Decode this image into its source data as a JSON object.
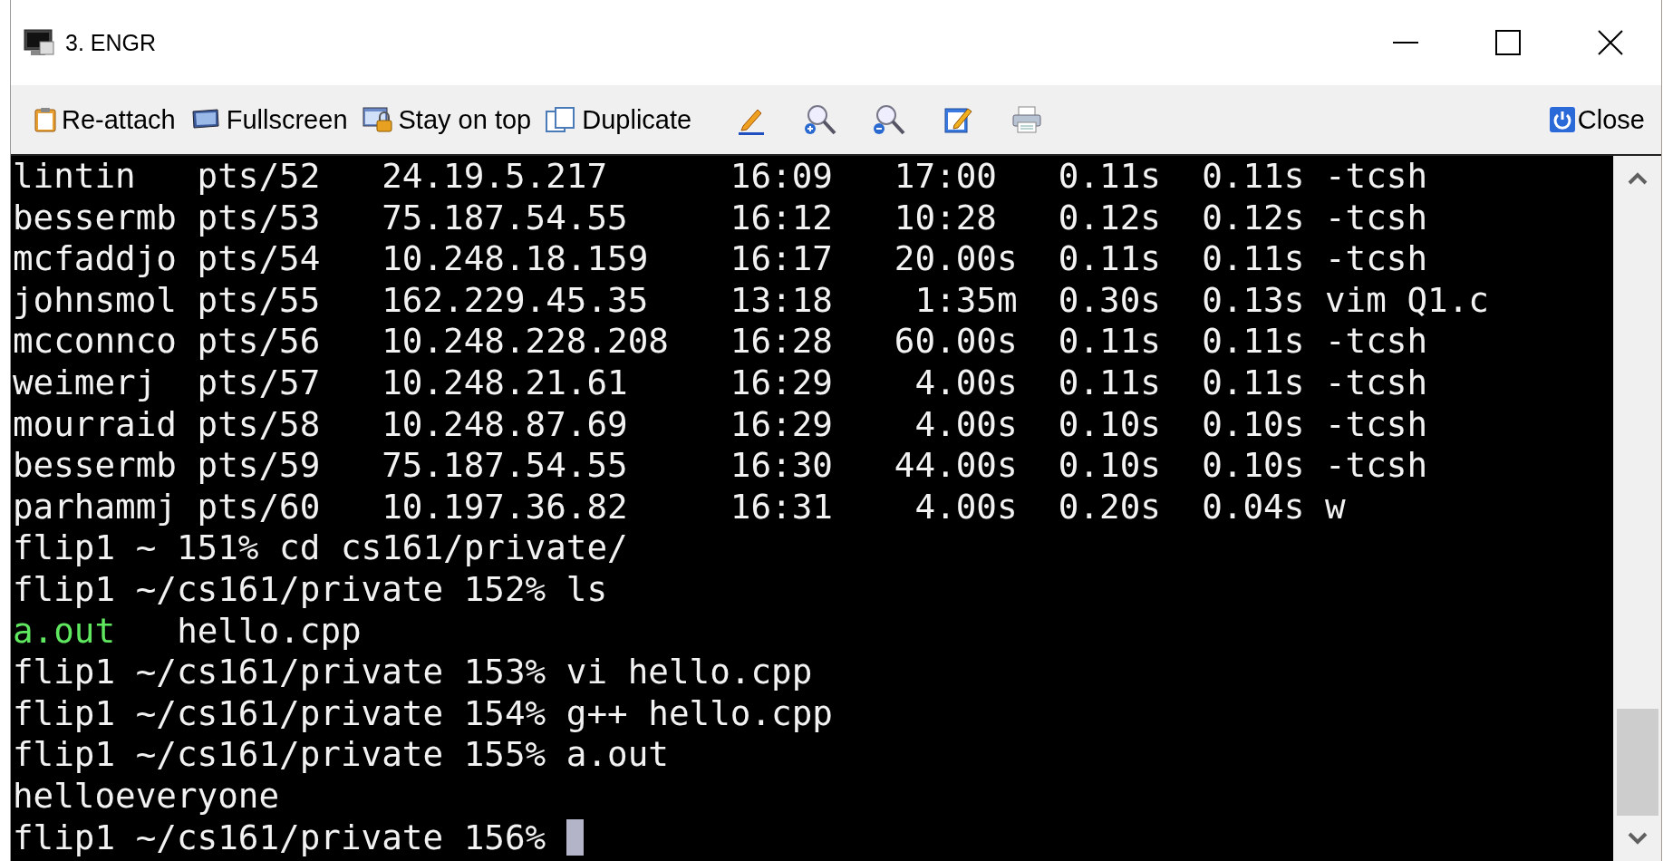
{
  "window": {
    "title": "3. ENGR"
  },
  "toolbar": {
    "buttons": [
      "Re-attach",
      "Fullscreen",
      "Stay on top",
      "Duplicate"
    ],
    "close_button": "Close"
  },
  "terminal": {
    "lines": [
      {
        "text": "lintin   pts/52   24.19.5.217      16:09   17:00   0.11s  0.11s -tcsh"
      },
      {
        "text": "bessermb pts/53   75.187.54.55     16:12   10:28   0.12s  0.12s -tcsh"
      },
      {
        "text": "mcfaddjo pts/54   10.248.18.159    16:17   20.00s  0.11s  0.11s -tcsh"
      },
      {
        "text": "johnsmol pts/55   162.229.45.35    13:18    1:35m  0.30s  0.13s vim Q1.c"
      },
      {
        "text": "mcconnco pts/56   10.248.228.208   16:28   60.00s  0.11s  0.11s -tcsh"
      },
      {
        "text": "weimerj  pts/57   10.248.21.61     16:29    4.00s  0.11s  0.11s -tcsh"
      },
      {
        "text": "mourraid pts/58   10.248.87.69     16:29    4.00s  0.10s  0.10s -tcsh"
      },
      {
        "text": "bessermb pts/59   75.187.54.55     16:30   44.00s  0.10s  0.10s -tcsh"
      },
      {
        "text": "parhammj pts/60   10.197.36.82     16:31    4.00s  0.20s  0.04s w"
      },
      {
        "text": "flip1 ~ 151% cd cs161/private/"
      },
      {
        "text": "flip1 ~/cs161/private 152% ls"
      },
      {
        "segments": [
          {
            "text": "a.out",
            "kind": "executable"
          },
          {
            "text": "hello.cpp",
            "kind": "file"
          }
        ]
      },
      {
        "text": "flip1 ~/cs161/private 153% vi hello.cpp"
      },
      {
        "text": "flip1 ~/cs161/private 154% g++ hello.cpp"
      },
      {
        "text": "flip1 ~/cs161/private 155% a.out"
      },
      {
        "text": "helloeveryone"
      },
      {
        "text": "flip1 ~/cs161/private 156%",
        "cursor": true
      }
    ]
  }
}
